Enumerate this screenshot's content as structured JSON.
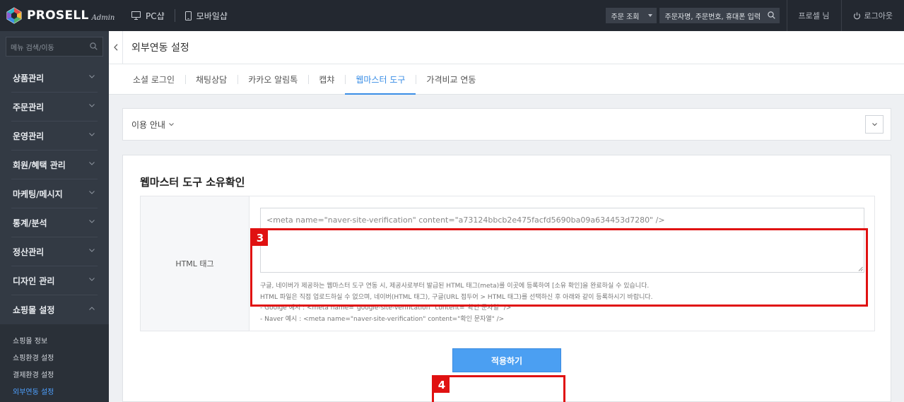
{
  "brand": {
    "name": "PROSELL",
    "sub": "Admin"
  },
  "topnav": {
    "pc": "PC샵",
    "mobile": "모바일샵"
  },
  "order": {
    "select_label": "주문 조회",
    "search_placeholder": "주문자명, 주문번호, 휴대폰 입력"
  },
  "user": {
    "name": "프로셀 님",
    "logout": "로그아웃"
  },
  "sidebar": {
    "search_placeholder": "메뉴 검색/이동",
    "items": [
      {
        "label": "상품관리"
      },
      {
        "label": "주문관리"
      },
      {
        "label": "운영관리"
      },
      {
        "label": "회원/혜택 관리"
      },
      {
        "label": "마케팅/메시지"
      },
      {
        "label": "통계/분석"
      },
      {
        "label": "정산관리"
      },
      {
        "label": "디자인 관리"
      },
      {
        "label": "쇼핑몰 설정"
      }
    ],
    "subitems": [
      {
        "label": "쇼핑몰 정보"
      },
      {
        "label": "쇼핑환경 설정"
      },
      {
        "label": "결제환경 설정"
      },
      {
        "label": "외부연동 설정"
      }
    ]
  },
  "page": {
    "title": "외부연동 설정"
  },
  "tabs": [
    {
      "label": "소셜 로그인"
    },
    {
      "label": "채팅상담"
    },
    {
      "label": "카카오 알림톡"
    },
    {
      "label": "캡챠"
    },
    {
      "label": "웹마스터 도구"
    },
    {
      "label": "가격비교 연동"
    }
  ],
  "guide": {
    "label": "이용 안내"
  },
  "panel": {
    "title": "웹마스터 도구 소유확인",
    "field_label": "HTML 태그",
    "tag_value": "<meta name=\"naver-site-verification\" content=\"a73124bbcb2e475facfd5690ba09a634453d7280\" />",
    "help": [
      "구글, 네이버가 제공하는 웹마스터 도구 연동 시, 제공사로부터 발급된 HTML 태그(meta)를 이곳에 등록하여 [소유 확인]을 완료하실 수 있습니다.",
      "HTML 파일은 직접 업로드하실 수 없으며, 네이버(HTML 태그), 구글(URL 접두어 > HTML 태그)를 선택하신 후 아래와 같이 등록하시기 바랍니다.",
      "- Goolge 예시 : <meta name=\"google-site-verification\" content=\"확인 문자열\" />",
      "- Naver 예시 : <meta name=\"naver-site-verification\" content=\"확인 문자열\" />"
    ],
    "apply_label": "적용하기"
  },
  "annotations": {
    "badge_3": "3",
    "badge_4": "4"
  },
  "colors": {
    "accent": "#3a8ee6",
    "button": "#4b9ff2",
    "highlight": "#e01111",
    "sidebar": "#333a44",
    "topbar": "#232830"
  }
}
